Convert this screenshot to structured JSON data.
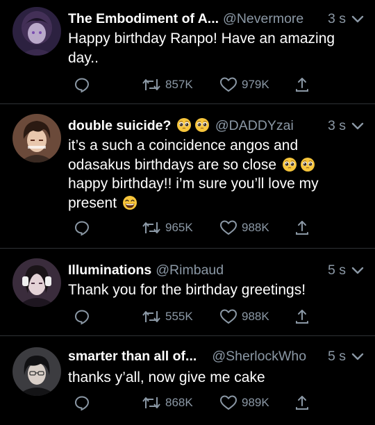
{
  "colors": {
    "background": "#000000",
    "text_primary": "#ffffff",
    "text_secondary": "#8b98a5",
    "divider": "#2f3336"
  },
  "tweets": [
    {
      "display_name": "The Embodiment of A...",
      "handle": "@Nevermore",
      "time": "3 s",
      "text": "Happy birthday Ranpo! Have an amazing day..",
      "retweets": "857K",
      "likes": "979K",
      "avatar_icon": "avatar-nevermore"
    },
    {
      "display_name": "double suicide?",
      "name_emojis": [
        "pleading-face",
        "pleading-face"
      ],
      "handle": "@DADDYzai",
      "time": "3 s",
      "text_part1": "it’s a such a coincidence angos and odasakus birthdays are so close",
      "text_emojis_1": [
        "pleading-face",
        "pleading-face"
      ],
      "text_part2": "happy birthday!! i’m sure you’ll love my present",
      "text_emoji_2": "grinning-face",
      "retweets": "965K",
      "likes": "988K",
      "avatar_icon": "avatar-daddyzai"
    },
    {
      "display_name": "Illuminations",
      "handle": "@Rimbaud",
      "time": "5 s",
      "text": "Thank you for the birthday greetings!",
      "retweets": "555K",
      "likes": "988K",
      "avatar_icon": "avatar-rimbaud"
    },
    {
      "display_name": "smarter than all of...",
      "handle": "@SherlockWho",
      "time": "5 s",
      "text": "thanks y’all, now give me cake",
      "retweets": "868K",
      "likes": "989K",
      "avatar_icon": "avatar-sherlockwho"
    }
  ],
  "icons": {
    "reply": "speech-bubble-icon",
    "retweet": "retweet-arrows-icon",
    "like": "heart-outline-icon",
    "share": "share-upload-icon",
    "menu": "chevron-down-icon"
  }
}
